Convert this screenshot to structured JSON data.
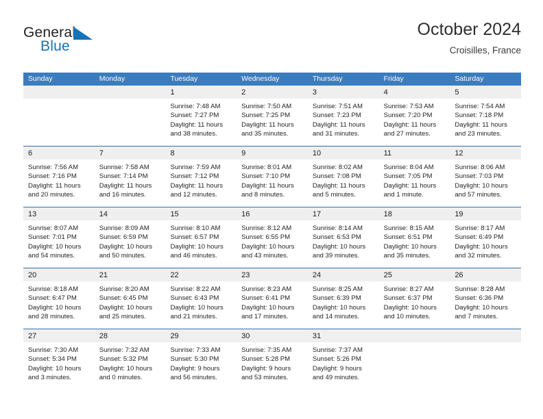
{
  "brand": {
    "name_part1": "General",
    "name_part2": "Blue",
    "logo_icon": "triangle-icon",
    "color_primary": "#1273b8"
  },
  "header": {
    "month_title": "October 2024",
    "location": "Croisilles, France"
  },
  "theme": {
    "header_blue": "#3b7cbe",
    "row_divider_blue": "#2f6fad",
    "day_strip_gray": "#efefef"
  },
  "calendar": {
    "weekdays": [
      "Sunday",
      "Monday",
      "Tuesday",
      "Wednesday",
      "Thursday",
      "Friday",
      "Saturday"
    ],
    "weeks": [
      [
        {
          "day": "",
          "sunrise": "",
          "sunset": "",
          "daylight_1": "",
          "daylight_2": ""
        },
        {
          "day": "",
          "sunrise": "",
          "sunset": "",
          "daylight_1": "",
          "daylight_2": ""
        },
        {
          "day": "1",
          "sunrise": "Sunrise: 7:48 AM",
          "sunset": "Sunset: 7:27 PM",
          "daylight_1": "Daylight: 11 hours",
          "daylight_2": "and 38 minutes."
        },
        {
          "day": "2",
          "sunrise": "Sunrise: 7:50 AM",
          "sunset": "Sunset: 7:25 PM",
          "daylight_1": "Daylight: 11 hours",
          "daylight_2": "and 35 minutes."
        },
        {
          "day": "3",
          "sunrise": "Sunrise: 7:51 AM",
          "sunset": "Sunset: 7:23 PM",
          "daylight_1": "Daylight: 11 hours",
          "daylight_2": "and 31 minutes."
        },
        {
          "day": "4",
          "sunrise": "Sunrise: 7:53 AM",
          "sunset": "Sunset: 7:20 PM",
          "daylight_1": "Daylight: 11 hours",
          "daylight_2": "and 27 minutes."
        },
        {
          "day": "5",
          "sunrise": "Sunrise: 7:54 AM",
          "sunset": "Sunset: 7:18 PM",
          "daylight_1": "Daylight: 11 hours",
          "daylight_2": "and 23 minutes."
        }
      ],
      [
        {
          "day": "6",
          "sunrise": "Sunrise: 7:56 AM",
          "sunset": "Sunset: 7:16 PM",
          "daylight_1": "Daylight: 11 hours",
          "daylight_2": "and 20 minutes."
        },
        {
          "day": "7",
          "sunrise": "Sunrise: 7:58 AM",
          "sunset": "Sunset: 7:14 PM",
          "daylight_1": "Daylight: 11 hours",
          "daylight_2": "and 16 minutes."
        },
        {
          "day": "8",
          "sunrise": "Sunrise: 7:59 AM",
          "sunset": "Sunset: 7:12 PM",
          "daylight_1": "Daylight: 11 hours",
          "daylight_2": "and 12 minutes."
        },
        {
          "day": "9",
          "sunrise": "Sunrise: 8:01 AM",
          "sunset": "Sunset: 7:10 PM",
          "daylight_1": "Daylight: 11 hours",
          "daylight_2": "and 8 minutes."
        },
        {
          "day": "10",
          "sunrise": "Sunrise: 8:02 AM",
          "sunset": "Sunset: 7:08 PM",
          "daylight_1": "Daylight: 11 hours",
          "daylight_2": "and 5 minutes."
        },
        {
          "day": "11",
          "sunrise": "Sunrise: 8:04 AM",
          "sunset": "Sunset: 7:05 PM",
          "daylight_1": "Daylight: 11 hours",
          "daylight_2": "and 1 minute."
        },
        {
          "day": "12",
          "sunrise": "Sunrise: 8:06 AM",
          "sunset": "Sunset: 7:03 PM",
          "daylight_1": "Daylight: 10 hours",
          "daylight_2": "and 57 minutes."
        }
      ],
      [
        {
          "day": "13",
          "sunrise": "Sunrise: 8:07 AM",
          "sunset": "Sunset: 7:01 PM",
          "daylight_1": "Daylight: 10 hours",
          "daylight_2": "and 54 minutes."
        },
        {
          "day": "14",
          "sunrise": "Sunrise: 8:09 AM",
          "sunset": "Sunset: 6:59 PM",
          "daylight_1": "Daylight: 10 hours",
          "daylight_2": "and 50 minutes."
        },
        {
          "day": "15",
          "sunrise": "Sunrise: 8:10 AM",
          "sunset": "Sunset: 6:57 PM",
          "daylight_1": "Daylight: 10 hours",
          "daylight_2": "and 46 minutes."
        },
        {
          "day": "16",
          "sunrise": "Sunrise: 8:12 AM",
          "sunset": "Sunset: 6:55 PM",
          "daylight_1": "Daylight: 10 hours",
          "daylight_2": "and 43 minutes."
        },
        {
          "day": "17",
          "sunrise": "Sunrise: 8:14 AM",
          "sunset": "Sunset: 6:53 PM",
          "daylight_1": "Daylight: 10 hours",
          "daylight_2": "and 39 minutes."
        },
        {
          "day": "18",
          "sunrise": "Sunrise: 8:15 AM",
          "sunset": "Sunset: 6:51 PM",
          "daylight_1": "Daylight: 10 hours",
          "daylight_2": "and 35 minutes."
        },
        {
          "day": "19",
          "sunrise": "Sunrise: 8:17 AM",
          "sunset": "Sunset: 6:49 PM",
          "daylight_1": "Daylight: 10 hours",
          "daylight_2": "and 32 minutes."
        }
      ],
      [
        {
          "day": "20",
          "sunrise": "Sunrise: 8:18 AM",
          "sunset": "Sunset: 6:47 PM",
          "daylight_1": "Daylight: 10 hours",
          "daylight_2": "and 28 minutes."
        },
        {
          "day": "21",
          "sunrise": "Sunrise: 8:20 AM",
          "sunset": "Sunset: 6:45 PM",
          "daylight_1": "Daylight: 10 hours",
          "daylight_2": "and 25 minutes."
        },
        {
          "day": "22",
          "sunrise": "Sunrise: 8:22 AM",
          "sunset": "Sunset: 6:43 PM",
          "daylight_1": "Daylight: 10 hours",
          "daylight_2": "and 21 minutes."
        },
        {
          "day": "23",
          "sunrise": "Sunrise: 8:23 AM",
          "sunset": "Sunset: 6:41 PM",
          "daylight_1": "Daylight: 10 hours",
          "daylight_2": "and 17 minutes."
        },
        {
          "day": "24",
          "sunrise": "Sunrise: 8:25 AM",
          "sunset": "Sunset: 6:39 PM",
          "daylight_1": "Daylight: 10 hours",
          "daylight_2": "and 14 minutes."
        },
        {
          "day": "25",
          "sunrise": "Sunrise: 8:27 AM",
          "sunset": "Sunset: 6:37 PM",
          "daylight_1": "Daylight: 10 hours",
          "daylight_2": "and 10 minutes."
        },
        {
          "day": "26",
          "sunrise": "Sunrise: 8:28 AM",
          "sunset": "Sunset: 6:36 PM",
          "daylight_1": "Daylight: 10 hours",
          "daylight_2": "and 7 minutes."
        }
      ],
      [
        {
          "day": "27",
          "sunrise": "Sunrise: 7:30 AM",
          "sunset": "Sunset: 5:34 PM",
          "daylight_1": "Daylight: 10 hours",
          "daylight_2": "and 3 minutes."
        },
        {
          "day": "28",
          "sunrise": "Sunrise: 7:32 AM",
          "sunset": "Sunset: 5:32 PM",
          "daylight_1": "Daylight: 10 hours",
          "daylight_2": "and 0 minutes."
        },
        {
          "day": "29",
          "sunrise": "Sunrise: 7:33 AM",
          "sunset": "Sunset: 5:30 PM",
          "daylight_1": "Daylight: 9 hours",
          "daylight_2": "and 56 minutes."
        },
        {
          "day": "30",
          "sunrise": "Sunrise: 7:35 AM",
          "sunset": "Sunset: 5:28 PM",
          "daylight_1": "Daylight: 9 hours",
          "daylight_2": "and 53 minutes."
        },
        {
          "day": "31",
          "sunrise": "Sunrise: 7:37 AM",
          "sunset": "Sunset: 5:26 PM",
          "daylight_1": "Daylight: 9 hours",
          "daylight_2": "and 49 minutes."
        },
        {
          "day": "",
          "sunrise": "",
          "sunset": "",
          "daylight_1": "",
          "daylight_2": ""
        },
        {
          "day": "",
          "sunrise": "",
          "sunset": "",
          "daylight_1": "",
          "daylight_2": ""
        }
      ]
    ]
  }
}
